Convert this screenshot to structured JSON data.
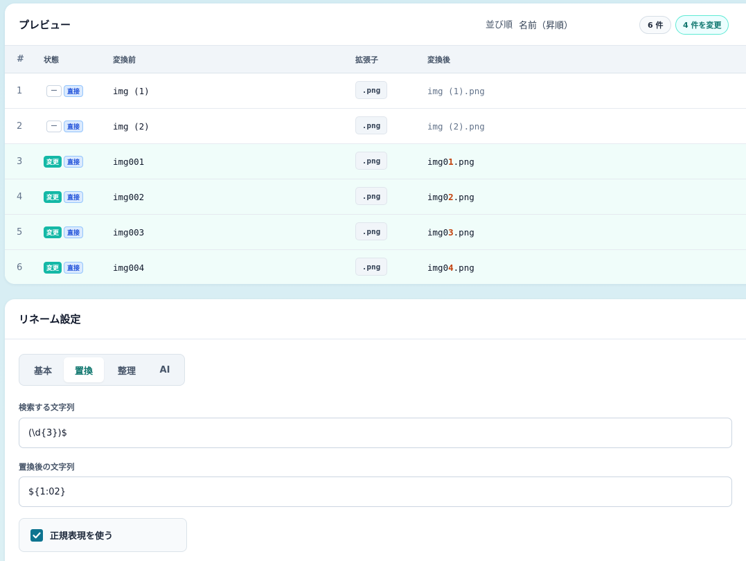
{
  "preview": {
    "title": "プレビュー",
    "sort_label": "並び順",
    "sort_value": "名前（昇順）",
    "count_badge": "6 件",
    "changed_badge": "4 件を変更",
    "columns": {
      "num": "#",
      "state": "状態",
      "before": "変換前",
      "ext": "拡張子",
      "after": "変換後"
    },
    "rows": [
      {
        "num": "1",
        "changed": false,
        "state_chip": "—",
        "mode_chip": "直接",
        "before": "img (1)",
        "ext": ".png",
        "after_prefix": "img (1).png",
        "after_hl": "",
        "after_suffix": ""
      },
      {
        "num": "2",
        "changed": false,
        "state_chip": "—",
        "mode_chip": "直接",
        "before": "img (2)",
        "ext": ".png",
        "after_prefix": "img (2).png",
        "after_hl": "",
        "after_suffix": ""
      },
      {
        "num": "3",
        "changed": true,
        "state_chip": "変更",
        "mode_chip": "直接",
        "before": "img001",
        "ext": ".png",
        "after_prefix": "img0",
        "after_hl": "1",
        "after_suffix": ".png"
      },
      {
        "num": "4",
        "changed": true,
        "state_chip": "変更",
        "mode_chip": "直接",
        "before": "img002",
        "ext": ".png",
        "after_prefix": "img0",
        "after_hl": "2",
        "after_suffix": ".png"
      },
      {
        "num": "5",
        "changed": true,
        "state_chip": "変更",
        "mode_chip": "直接",
        "before": "img003",
        "ext": ".png",
        "after_prefix": "img0",
        "after_hl": "3",
        "after_suffix": ".png"
      },
      {
        "num": "6",
        "changed": true,
        "state_chip": "変更",
        "mode_chip": "直接",
        "before": "img004",
        "ext": ".png",
        "after_prefix": "img0",
        "after_hl": "4",
        "after_suffix": ".png"
      }
    ]
  },
  "settings": {
    "title": "リネーム設定",
    "tabs": [
      {
        "label": "基本",
        "active": false
      },
      {
        "label": "置換",
        "active": true
      },
      {
        "label": "整理",
        "active": false
      },
      {
        "label": "AI",
        "active": false
      }
    ],
    "search_label": "検索する文字列",
    "search_value": "(\\d{3})$",
    "replace_label": "置換後の文字列",
    "replace_value": "${1:02}",
    "regex_label": "正規表現を使う",
    "regex_checked": true
  },
  "colors": {
    "accent": "#0f766e",
    "change_chip": "#14b8a6",
    "highlight": "#c2410c",
    "checkbox": "#0e7490"
  }
}
